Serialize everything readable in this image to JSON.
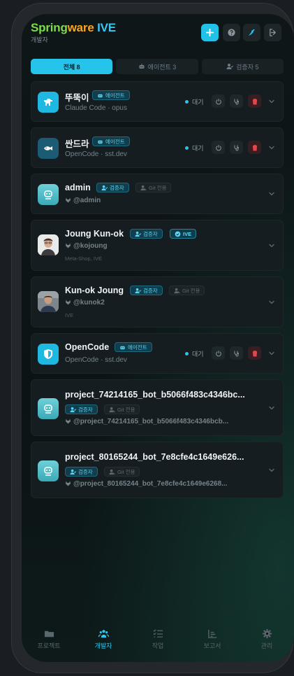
{
  "app": {
    "brand_part1": "Spring",
    "brand_part2": "ware",
    "brand_part3": " IVE",
    "subtitle": "개발자"
  },
  "header_icons": [
    "plus-icon",
    "help-icon",
    "bird-icon",
    "logout-icon"
  ],
  "tabs": [
    {
      "label": "전체 8"
    },
    {
      "label": "에이전트 3"
    },
    {
      "label": "검증자 5"
    }
  ],
  "cards": [
    {
      "name": "뚜뚝이",
      "badge": "에이전트",
      "sub": "Claude Code · opus",
      "status": "대기"
    },
    {
      "name": "싼드라",
      "badge": "에이전트",
      "sub": "OpenCode · sst.dev",
      "status": "대기"
    },
    {
      "name": "admin",
      "badge": "검증자",
      "git": "Git 전용",
      "handle": "@admin"
    },
    {
      "name": "Joung Kun-ok",
      "badge": "검증자",
      "badge2": "IVE",
      "handle": "@kojoung",
      "meta": "Meta-Shop, IVE"
    },
    {
      "name": "Kun-ok Joung",
      "badge": "검증자",
      "git": "Git 전용",
      "handle": "@kunok2",
      "meta": "IVE"
    },
    {
      "name": "OpenCode",
      "badge": "에이전트",
      "sub": "OpenCode · sst.dev",
      "status": "대기"
    },
    {
      "name": "project_74214165_bot_b5066f483c4346bc...",
      "badge": "검증자",
      "git": "Git 전용",
      "handle": "@project_74214165_bot_b5066f483c4346bcb..."
    },
    {
      "name": "project_80165244_bot_7e8cfe4c1649e626...",
      "badge": "검증자",
      "git": "Git 전용",
      "handle": "@project_80165244_bot_7e8cfe4c1649e6268..."
    }
  ],
  "nav": [
    {
      "label": "프로젝트",
      "icon": "folder-icon"
    },
    {
      "label": "개발자",
      "icon": "users-icon"
    },
    {
      "label": "작업",
      "icon": "checklist-icon"
    },
    {
      "label": "보고서",
      "icon": "chart-icon"
    },
    {
      "label": "관리",
      "icon": "gear-icon"
    }
  ],
  "colors": {
    "accent": "#26c4ea",
    "brand_green": "#7ddc4a",
    "brand_orange": "#f5a623",
    "delete_red": "#e2474f"
  }
}
